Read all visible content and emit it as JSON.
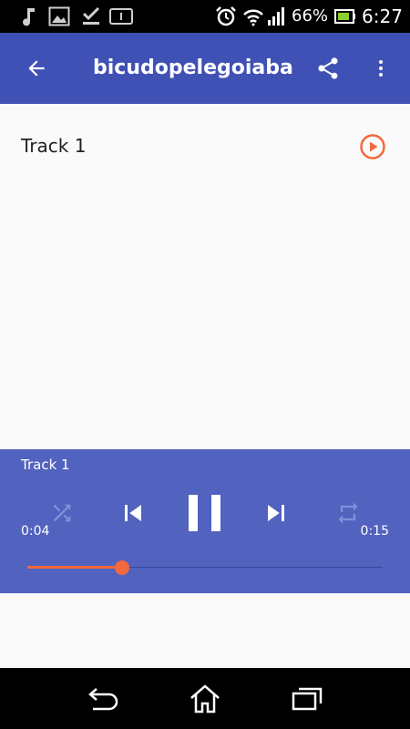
{
  "status_bar": {
    "battery_percent": "66%",
    "time": "6:27",
    "icons": [
      "music-note-icon",
      "image-icon",
      "download-done-icon",
      "info-card-icon",
      "alarm-icon",
      "wifi-icon",
      "signal-icon",
      "battery-icon"
    ]
  },
  "app_bar": {
    "title": "bicudopelegoiaba",
    "back_icon": "arrow-back-icon",
    "share_icon": "share-icon",
    "menu_icon": "more-vert-icon"
  },
  "tracks": [
    {
      "name": "Track 1",
      "action_icon": "play-circle-icon"
    }
  ],
  "player": {
    "now_playing": "Track 1",
    "elapsed": "0:04",
    "duration": "0:15",
    "progress_fraction": 0.2667,
    "shuffle_enabled": false,
    "repeat_enabled": false,
    "playing": true
  },
  "nav_bar": {
    "icons": [
      "nav-back-icon",
      "nav-home-icon",
      "nav-recents-icon"
    ]
  },
  "colors": {
    "primary": "#3f51b5",
    "player_bg": "#5262bf",
    "accent": "#f4683f",
    "text_primary": "#212121"
  }
}
